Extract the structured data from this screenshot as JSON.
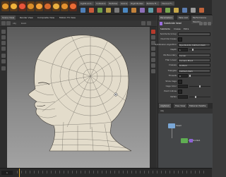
{
  "colors": {
    "accent_purple": "#9b6de0",
    "node_blue": "#7aa7d6",
    "node_green": "#5fae52",
    "playhead": "#d8a531",
    "mesh_fill": "#e3dccb",
    "mesh_wire": "#6f6b63"
  },
  "shelf": {
    "tools": [
      "tool-icon",
      "tool-icon",
      "tool-icon",
      "tool-icon",
      "tool-icon",
      "tool-icon",
      "tool-icon",
      "tool-icon",
      "tool-icon"
    ],
    "tabs": [
      "Lights and...",
      "Collisions",
      "Particles",
      "Grains",
      "Rigid Bodies",
      "Particle Fl...",
      "Viscous Fl..."
    ]
  },
  "viewport": {
    "tabs": [
      "Scene View",
      "Render View",
      "Composite View",
      "Motion FX View"
    ],
    "header_items": [
      "obj",
      "box1"
    ],
    "subject": "head-mesh"
  },
  "panel": {
    "tabs": [
      "Parameters",
      "Take List",
      "Performance Monitor"
    ],
    "node_title": "Subdivide head",
    "param_tabs": [
      "Subdivide",
      "Crease",
      "Extra"
    ],
    "params": [
      {
        "label": "Subdivide Group",
        "type": "select",
        "value": ""
      },
      {
        "label": "Override Crease",
        "type": "check"
      },
      {
        "label": "Subdivision Algorithm",
        "type": "select",
        "value": "OpenSubdiv Catmull-Clark"
      },
      {
        "label": "Depth",
        "type": "field",
        "value": "1",
        "slider": 0.15
      },
      {
        "label": "Vtx Boundary",
        "type": "select",
        "value": "Corner"
      },
      {
        "label": "FVar Linear",
        "type": "select",
        "value": "Corners Plus1"
      },
      {
        "label": "Creases",
        "type": "select",
        "value": "Uniform"
      },
      {
        "label": "Triangles",
        "type": "select",
        "value": "Catmull-Clark"
      },
      {
        "label": "Threads",
        "type": "field",
        "value": "0",
        "slider": 0.0
      },
      {
        "label": "Show Cage",
        "type": "check"
      },
      {
        "label": "Cage Color",
        "type": "field",
        "value": "",
        "slider": 0.5
      },
      {
        "label": "Point Indices",
        "type": "check"
      },
      {
        "label": "Vertex",
        "type": "field",
        "value": "",
        "slider": 0.3
      }
    ],
    "network_tabs": [
      "obj/box1",
      "Tree View",
      "Material Palette"
    ],
    "network_path": "obj",
    "nodes": [
      {
        "name": "head",
        "color": "#7aa7d6"
      },
      {
        "name": "subdivide1",
        "color": "#5fae52"
      }
    ]
  },
  "timeline": {
    "frame": "1"
  }
}
